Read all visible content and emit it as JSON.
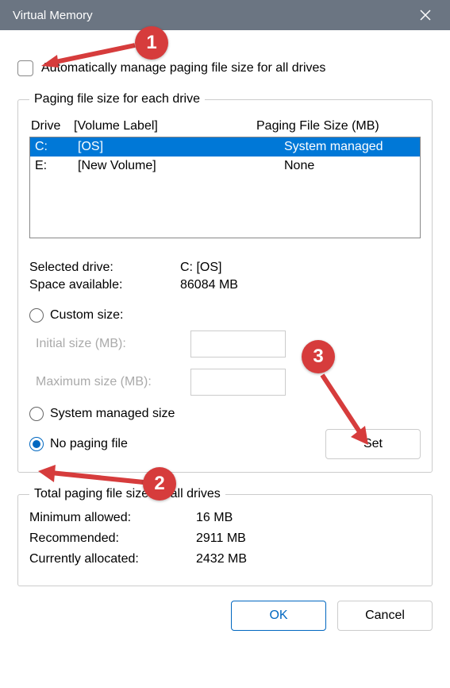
{
  "window": {
    "title": "Virtual Memory"
  },
  "auto_manage": {
    "label": "Automatically manage paging file size for all drives",
    "checked": false
  },
  "drives_group": {
    "legend": "Paging file size for each drive",
    "headers": {
      "drive": "Drive",
      "volume": "[Volume Label]",
      "size": "Paging File Size (MB)"
    },
    "rows": [
      {
        "drive": "C:",
        "volume": "[OS]",
        "size": "System managed",
        "selected": true
      },
      {
        "drive": "E:",
        "volume": "[New Volume]",
        "size": "None",
        "selected": false
      }
    ],
    "selected": {
      "label": "Selected drive:",
      "value": "C:  [OS]"
    },
    "space": {
      "label": "Space available:",
      "value": "86084 MB"
    },
    "custom": {
      "label": "Custom size:",
      "initial_label": "Initial size (MB):",
      "initial_value": "",
      "max_label": "Maximum size (MB):",
      "max_value": ""
    },
    "system_managed_label": "System managed size",
    "no_paging_label": "No paging file",
    "set_label": "Set",
    "selected_option": "no_paging"
  },
  "totals_group": {
    "legend": "Total paging file size for all drives",
    "min": {
      "label": "Minimum allowed:",
      "value": "16 MB"
    },
    "rec": {
      "label": "Recommended:",
      "value": "2911 MB"
    },
    "cur": {
      "label": "Currently allocated:",
      "value": "2432 MB"
    }
  },
  "buttons": {
    "ok": "OK",
    "cancel": "Cancel"
  },
  "callouts": {
    "c1": "1",
    "c2": "2",
    "c3": "3"
  }
}
